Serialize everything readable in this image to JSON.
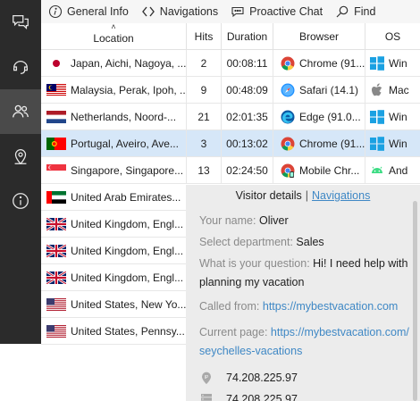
{
  "toolbar": {
    "general_info": "General Info",
    "navigations": "Navigations",
    "proactive_chat": "Proactive Chat",
    "find": "Find"
  },
  "table": {
    "headers": [
      "Location",
      "Hits",
      "Duration",
      "Browser",
      "OS"
    ],
    "rows": [
      {
        "flag": "japan",
        "location": "Japan, Aichi, Nagoya, ...",
        "hits": "2",
        "duration": "00:08:11",
        "browser_icon": "chrome-icon",
        "browser": "Chrome (91...",
        "os_icon": "windows-icon",
        "os": "Win"
      },
      {
        "flag": "malaysia",
        "location": "Malaysia, Perak, Ipoh, ...",
        "hits": "9",
        "duration": "00:48:09",
        "browser_icon": "safari-icon",
        "browser": "Safari (14.1)",
        "os_icon": "apple-icon",
        "os": "Mac"
      },
      {
        "flag": "netherlands",
        "location": "Netherlands, Noord-...",
        "hits": "21",
        "duration": "02:01:35",
        "browser_icon": "edge-icon",
        "browser": "Edge (91.0...",
        "os_icon": "windows-icon",
        "os": "Win"
      },
      {
        "flag": "portugal",
        "location": "Portugal, Aveiro, Ave...",
        "hits": "3",
        "duration": "00:13:02",
        "browser_icon": "chrome-icon",
        "browser": "Chrome (91...",
        "os_icon": "windows-icon",
        "os": "Win"
      },
      {
        "flag": "singapore",
        "location": "Singapore, Singapore...",
        "hits": "13",
        "duration": "02:24:50",
        "browser_icon": "mobile-chrome-icon",
        "browser": "Mobile Chr...",
        "os_icon": "android-icon",
        "os": "And"
      },
      {
        "flag": "uae",
        "location": "United Arab Emirates..."
      },
      {
        "flag": "uk",
        "location": "United Kingdom, Engl..."
      },
      {
        "flag": "uk",
        "location": "United Kingdom, Engl..."
      },
      {
        "flag": "uk",
        "location": "United Kingdom, Engl..."
      },
      {
        "flag": "usa",
        "location": "United States, New Yo..."
      },
      {
        "flag": "usa",
        "location": "United States, Pennsy..."
      }
    ],
    "selected_row": 3
  },
  "details": {
    "tab_active": "Visitor details",
    "tab_separator": "|",
    "tab_link": "Navigations",
    "name_label": "Your name:",
    "name_value": "Oliver",
    "department_label": "Select department:",
    "department_value": "Sales",
    "question_label": "What is your question:",
    "question_value_1": "Hi! I need help with",
    "question_value_2": "planning my vacation",
    "called_from_label": "Called from:",
    "called_from_value": "https://mybestvacation.com",
    "current_page_label": "Current page:",
    "current_page_value_1": "https://mybestvacation.com/",
    "current_page_value_2": "seychelles-vacations",
    "ip_value": "74.208.225.97",
    "host_value": "74.208.225.97"
  },
  "colors": {
    "sidebar": "#2b2b2b",
    "sidebar_active": "#4a4a4a",
    "selected_row": "#d6e7f8",
    "link": "#3f88c5",
    "panel": "#ececec"
  }
}
